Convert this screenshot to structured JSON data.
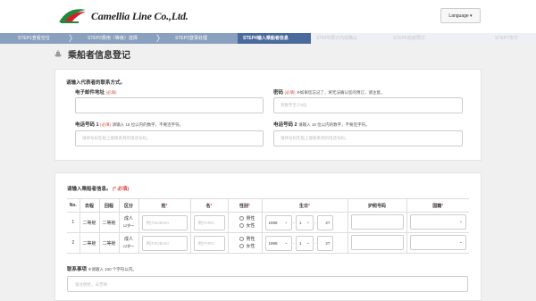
{
  "header": {
    "brand": "Camellia Line Co.,Ltd.",
    "language_button": "Language ▾",
    "colors": {
      "logo_red": "#d81e2a",
      "logo_green": "#1f8a3a",
      "step_active": "#4a6a9c",
      "step_done": "#8aa0bf"
    }
  },
  "steps": [
    {
      "label": "STEP1查看空位",
      "state": "done"
    },
    {
      "label": "STEP2费用（等级）选择",
      "state": "done"
    },
    {
      "label": "STEP3登录处理",
      "state": "done"
    },
    {
      "label": "STEP4输入乘船者信息",
      "state": "active"
    },
    {
      "label": "STEP5预订内容确认",
      "state": "todo"
    },
    {
      "label": "STEP6完成预订",
      "state": "todo"
    },
    {
      "label": "STEP7支付",
      "state": "todo"
    }
  ],
  "page": {
    "title": "乘船者信息登记",
    "title_icon": "ship-icon"
  },
  "rep": {
    "section_label": "请输入代表者的联系方式。",
    "email_label": "电子邮件地址",
    "email_req": "(必填)",
    "password_label": "密码",
    "password_req": "(必填)",
    "password_note": "※如果您忘记了，将无法确认您的预订，请注意。",
    "password_placeholder": "英数字至少8位",
    "phone1_label": "电话号码 1",
    "phone1_req": "(必填)",
    "phone1_note": "请输入 15 位以内的数字，不要连字符。",
    "phone1_placeholder": "请将号码在船上能联系到的电话号码。",
    "phone2_label": "电话号码 2",
    "phone2_note": "请输入 15 位以内的数字，不要连字符。",
    "phone2_placeholder": "请将号码在船上能联系到的电话号码。"
  },
  "pax": {
    "section_label": "请输入乘船者信息。",
    "section_req": "(* 必填)",
    "headers": {
      "no": "No.",
      "outbound": "去程",
      "return": "回程",
      "category": "区分",
      "surname": "姓",
      "given": "名",
      "gender": "性别",
      "birthday": "生日",
      "passport": "护照号码",
      "nationality": "国籍",
      "required_mark": "*"
    },
    "rows": [
      {
        "no": "1",
        "outbound": "二等舱",
        "return": "二等舱",
        "category": "成人",
        "category_sub": "12岁～",
        "surname_placeholder": "例)TSUBAKI",
        "given_placeholder": "例)TARO",
        "gender_male": "男性",
        "gender_female": "女性",
        "birth_year": "1998",
        "birth_month": "1",
        "birth_day": "27"
      },
      {
        "no": "2",
        "outbound": "二等舱",
        "return": "二等舱",
        "category": "成人",
        "category_sub": "12岁～",
        "surname_placeholder": "例)TSUBAKI",
        "given_placeholder": "例)TARO",
        "gender_male": "男性",
        "gender_female": "女性",
        "birth_year": "1998",
        "birth_month": "1",
        "birth_day": "27"
      }
    ]
  },
  "contact": {
    "label": "联系事项",
    "note": "※请输入 100 个字符以内。",
    "placeholder": "请注明坑，辛苦啊"
  }
}
